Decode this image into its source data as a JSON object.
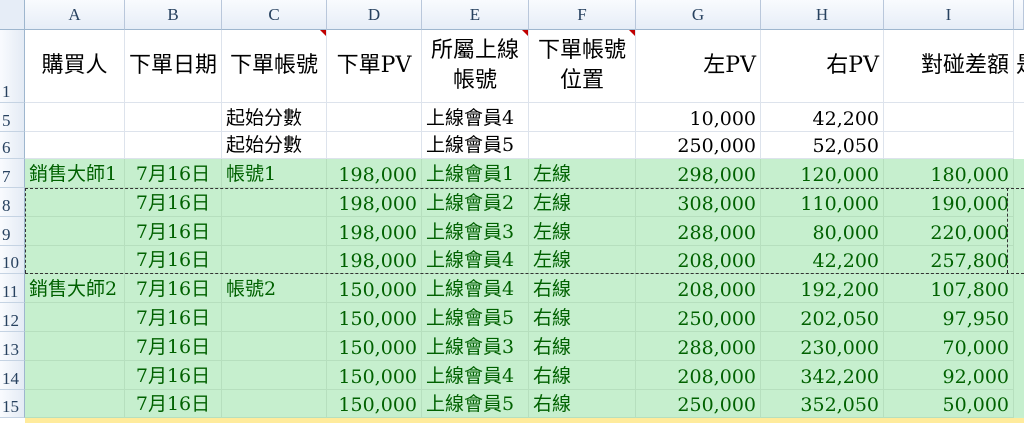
{
  "columns": [
    "A",
    "B",
    "C",
    "D",
    "E",
    "F",
    "G",
    "H",
    "I"
  ],
  "header_row": {
    "row_label": "1",
    "cells": [
      "購買人",
      "下單日期",
      "下單帳號",
      "下單PV",
      "所屬上線帳號",
      "下單帳號位置",
      "左PV",
      "右PV",
      "對碰差額",
      "是"
    ]
  },
  "start_rows": [
    {
      "row_label": "5",
      "c": "起始分數",
      "e": "上線會員4",
      "g": "10,000",
      "h": "42,200"
    },
    {
      "row_label": "6",
      "c": "起始分數",
      "e": "上線會員5",
      "g": "250,000",
      "h": "52,050"
    }
  ],
  "data_rows": [
    {
      "row_label": "7",
      "a": "銷售大師1",
      "b": "7月16日",
      "c": "帳號1",
      "d": "198,000",
      "e": "上線會員1",
      "f": "左線",
      "g": "298,000",
      "h": "120,000",
      "i": "180,000"
    },
    {
      "row_label": "8",
      "a": "",
      "b": "7月16日",
      "c": "",
      "d": "198,000",
      "e": "上線會員2",
      "f": "左線",
      "g": "308,000",
      "h": "110,000",
      "i": "190,000"
    },
    {
      "row_label": "9",
      "a": "",
      "b": "7月16日",
      "c": "",
      "d": "198,000",
      "e": "上線會員3",
      "f": "左線",
      "g": "288,000",
      "h": "80,000",
      "i": "220,000"
    },
    {
      "row_label": "10",
      "a": "",
      "b": "7月16日",
      "c": "",
      "d": "198,000",
      "e": "上線會員4",
      "f": "左線",
      "g": "208,000",
      "h": "42,200",
      "i": "257,800"
    },
    {
      "row_label": "11",
      "a": "銷售大師2",
      "b": "7月16日",
      "c": "帳號2",
      "d": "150,000",
      "e": "上線會員4",
      "f": "右線",
      "g": "208,000",
      "h": "192,200",
      "i": "107,800"
    },
    {
      "row_label": "12",
      "a": "",
      "b": "7月16日",
      "c": "",
      "d": "150,000",
      "e": "上線會員5",
      "f": "右線",
      "g": "250,000",
      "h": "202,050",
      "i": "97,950"
    },
    {
      "row_label": "13",
      "a": "",
      "b": "7月16日",
      "c": "",
      "d": "150,000",
      "e": "上線會員3",
      "f": "右線",
      "g": "288,000",
      "h": "230,000",
      "i": "70,000"
    },
    {
      "row_label": "14",
      "a": "",
      "b": "7月16日",
      "c": "",
      "d": "150,000",
      "e": "上線會員4",
      "f": "右線",
      "g": "208,000",
      "h": "342,200",
      "i": "92,000"
    },
    {
      "row_label": "15",
      "a": "",
      "b": "7月16日",
      "c": "",
      "d": "150,000",
      "e": "上線會員5",
      "f": "右線",
      "g": "250,000",
      "h": "352,050",
      "i": "50,000"
    }
  ],
  "colors": {
    "data_fill": "#c6efce",
    "data_text": "#006100",
    "comment_marker": "#c00000"
  }
}
